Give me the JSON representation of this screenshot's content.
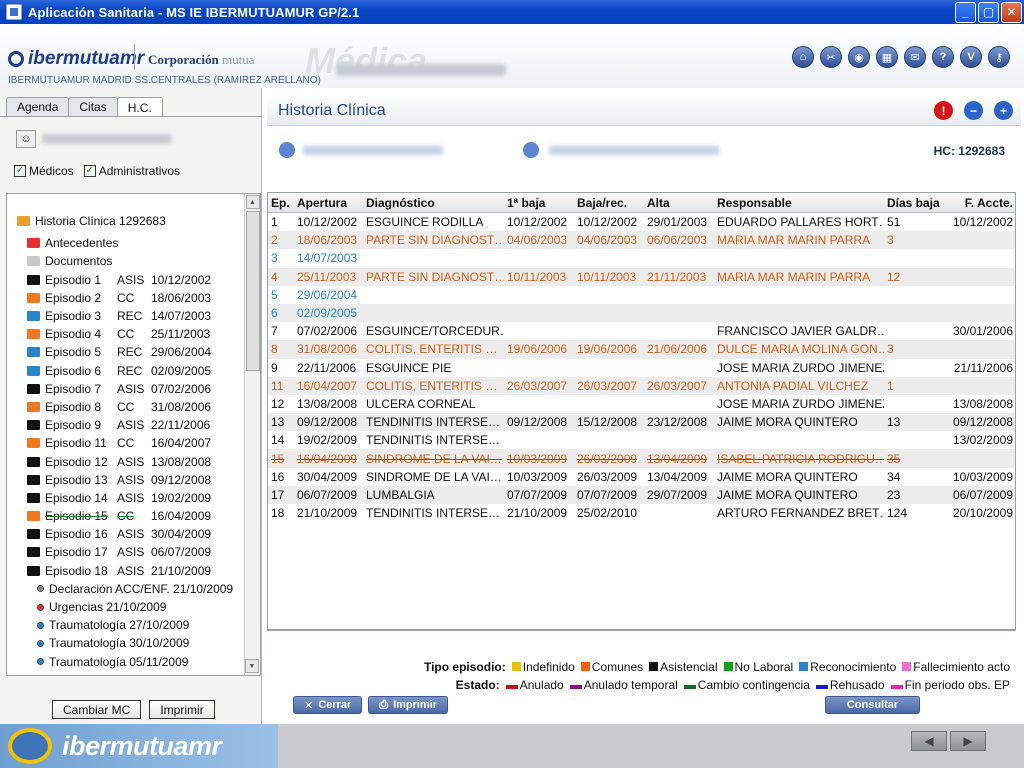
{
  "window": {
    "title": "Aplicación Sanitaria - MS IE IBERMUTUAMUR GP/2.1"
  },
  "header": {
    "logo_ibermutuamur": "ibermutuamr",
    "logo_corporacion": "Corporación",
    "logo_mutua": "mutua",
    "watermark": "Médica",
    "center": "IBERMUTUAMUR MADRID SS.CENTRALES (RAMIREZ ARELLANO)",
    "icons": [
      "home-icon",
      "tools-icon",
      "location-icon",
      "calculator-icon",
      "mail-icon",
      "help-icon",
      "user-icon",
      "key-icon"
    ],
    "icon_glyphs": [
      "⌂",
      "✂",
      "◉",
      "▦",
      "✉",
      "?",
      "V",
      "⚷"
    ]
  },
  "left": {
    "tabs": [
      "Agenda",
      "Citas",
      "H.C."
    ],
    "active_tab": "H.C.",
    "filters": [
      {
        "label": "Médicos",
        "checked": true
      },
      {
        "label": "Administrativos",
        "checked": true
      }
    ],
    "tree": [
      {
        "text": "Historia Clínica 1292683",
        "kind": "root",
        "color": "#e8a030"
      },
      {
        "text": "Antecedentes",
        "kind": "folder",
        "color": "#e83030"
      },
      {
        "text": "Documentos",
        "kind": "folder",
        "color": "#c8c8c8"
      },
      {
        "ep": "Episodio 1",
        "type": "ASIS",
        "date": "10/12/2002",
        "color": "#111111"
      },
      {
        "ep": "Episodio 2",
        "type": "CC",
        "date": "18/06/2003",
        "color": "#f07820"
      },
      {
        "ep": "Episodio 3",
        "type": "REC",
        "date": "14/07/2003",
        "color": "#2a85c8"
      },
      {
        "ep": "Episodio 4",
        "type": "CC",
        "date": "25/11/2003",
        "color": "#f07820"
      },
      {
        "ep": "Episodio 5",
        "type": "REC",
        "date": "29/06/2004",
        "color": "#2a85c8"
      },
      {
        "ep": "Episodio 6",
        "type": "REC",
        "date": "02/09/2005",
        "color": "#2a85c8"
      },
      {
        "ep": "Episodio 7",
        "type": "ASIS",
        "date": "07/02/2006",
        "color": "#111111"
      },
      {
        "ep": "Episodio 8",
        "type": "CC",
        "date": "31/08/2006",
        "color": "#f07820"
      },
      {
        "ep": "Episodio 9",
        "type": "ASIS",
        "date": "22/11/2006",
        "color": "#111111"
      },
      {
        "ep": "Episodio 11",
        "type": "CC",
        "date": "16/04/2007",
        "color": "#f07820"
      },
      {
        "ep": "Episodio 12",
        "type": "ASIS",
        "date": "13/08/2008",
        "color": "#111111"
      },
      {
        "ep": "Episodio 13",
        "type": "ASIS",
        "date": "09/12/2008",
        "color": "#111111"
      },
      {
        "ep": "Episodio 14",
        "type": "ASIS",
        "date": "19/02/2009",
        "color": "#111111"
      },
      {
        "ep": "Episodio 15",
        "type": "CC",
        "date": "16/04/2009",
        "color": "#f07820",
        "struck": true
      },
      {
        "ep": "Episodio 16",
        "type": "ASIS",
        "date": "30/04/2009",
        "color": "#111111"
      },
      {
        "ep": "Episodio 17",
        "type": "ASIS",
        "date": "06/07/2009",
        "color": "#111111"
      },
      {
        "ep": "Episodio 18",
        "type": "ASIS",
        "date": "21/10/2009",
        "color": "#111111"
      },
      {
        "text": "Declaración ACC/ENF. 21/10/2009",
        "kind": "child",
        "color": "#8a8a8a"
      },
      {
        "text": "Urgencias 21/10/2009",
        "kind": "child",
        "color": "#e83030"
      },
      {
        "text": "Traumatología 27/10/2009",
        "kind": "child",
        "color": "#2a85c8"
      },
      {
        "text": "Traumatología 30/10/2009",
        "kind": "child",
        "color": "#2a85c8"
      },
      {
        "text": "Traumatología 05/11/2009",
        "kind": "child",
        "color": "#2a85c8"
      }
    ],
    "buttons": {
      "change": "Cambiar MC",
      "print": "Imprimir"
    }
  },
  "main": {
    "title": "Historia Clínica",
    "hc_label": "HC:",
    "hc_number": "1292683",
    "columns": [
      "Ep.",
      "Apertura",
      "Diagnóstico",
      "1ª baja",
      "Baja/rec.",
      "Alta",
      "Responsable",
      "Días baja",
      "F. Accte."
    ],
    "rows": [
      {
        "ep": "1",
        "ap": "10/12/2002",
        "dx": "ESGUINCE RODILLA",
        "b1": "10/12/2002",
        "br": "10/12/2002",
        "al": "29/01/2003",
        "re": "EDUARDO PALLARES HORT…",
        "db": "51",
        "fa": "10/12/2002",
        "c": "black"
      },
      {
        "ep": "2",
        "ap": "18/06/2003",
        "dx": "PARTE SIN DIAGNOST…",
        "b1": "04/06/2003",
        "br": "04/06/2003",
        "al": "06/06/2003",
        "re": "MARIA MAR MARIN PARRA",
        "db": "3",
        "fa": "",
        "c": "orange"
      },
      {
        "ep": "3",
        "ap": "14/07/2003",
        "dx": "",
        "b1": "",
        "br": "",
        "al": "",
        "re": "",
        "db": "",
        "fa": "",
        "c": "blue"
      },
      {
        "ep": "4",
        "ap": "25/11/2003",
        "dx": "PARTE SIN DIAGNOST…",
        "b1": "10/11/2003",
        "br": "10/11/2003",
        "al": "21/11/2003",
        "re": "MARIA MAR MARIN PARRA",
        "db": "12",
        "fa": "",
        "c": "orange"
      },
      {
        "ep": "5",
        "ap": "29/06/2004",
        "dx": "",
        "b1": "",
        "br": "",
        "al": "",
        "re": "",
        "db": "",
        "fa": "",
        "c": "blue"
      },
      {
        "ep": "6",
        "ap": "02/09/2005",
        "dx": "",
        "b1": "",
        "br": "",
        "al": "",
        "re": "",
        "db": "",
        "fa": "",
        "c": "blue"
      },
      {
        "ep": "7",
        "ap": "07/02/2006",
        "dx": "ESGUINCE/TORCEDUR…",
        "b1": "",
        "br": "",
        "al": "",
        "re": "FRANCISCO JAVIER GALDR…",
        "db": "",
        "fa": "30/01/2006",
        "c": "black"
      },
      {
        "ep": "8",
        "ap": "31/08/2006",
        "dx": "COLITIS, ENTERITIS …",
        "b1": "19/06/2006",
        "br": "19/06/2006",
        "al": "21/06/2006",
        "re": "DULCE MARIA MOLINA GON…",
        "db": "3",
        "fa": "",
        "c": "orange"
      },
      {
        "ep": "9",
        "ap": "22/11/2006",
        "dx": "ESGUINCE PIE",
        "b1": "",
        "br": "",
        "al": "",
        "re": "JOSE MARIA ZURDO JIMENEZ",
        "db": "",
        "fa": "21/11/2006",
        "c": "black"
      },
      {
        "ep": "11",
        "ap": "16/04/2007",
        "dx": "COLITIS, ENTERITIS …",
        "b1": "26/03/2007",
        "br": "26/03/2007",
        "al": "26/03/2007",
        "re": "ANTONIA PADIAL VILCHEZ",
        "db": "1",
        "fa": "",
        "c": "orange"
      },
      {
        "ep": "12",
        "ap": "13/08/2008",
        "dx": "ULCERA CORNEAL",
        "b1": "",
        "br": "",
        "al": "",
        "re": "JOSE MARIA ZURDO JIMENEZ",
        "db": "",
        "fa": "13/08/2008",
        "c": "black"
      },
      {
        "ep": "13",
        "ap": "09/12/2008",
        "dx": "TENDINITIS INTERSE…",
        "b1": "09/12/2008",
        "br": "15/12/2008",
        "al": "23/12/2008",
        "re": "JAIME MORA QUINTERO",
        "db": "13",
        "fa": "09/12/2008",
        "c": "black"
      },
      {
        "ep": "14",
        "ap": "19/02/2009",
        "dx": "TENDINITIS INTERSE…",
        "b1": "",
        "br": "",
        "al": "",
        "re": "",
        "db": "",
        "fa": "13/02/2009",
        "c": "black"
      },
      {
        "ep": "15",
        "ap": "16/04/2009",
        "dx": "SINDROME DE LA VAI…",
        "b1": "10/03/2009",
        "br": "26/03/2009",
        "al": "13/04/2009",
        "re": "ISABEL PATRICIA RODRIGU…",
        "db": "35",
        "fa": "",
        "c": "orange",
        "annulled": true
      },
      {
        "ep": "16",
        "ap": "30/04/2009",
        "dx": "SINDROME DE LA VAI…",
        "b1": "10/03/2009",
        "br": "26/03/2009",
        "al": "13/04/2009",
        "re": "JAIME MORA QUINTERO",
        "db": "34",
        "fa": "10/03/2009",
        "c": "black"
      },
      {
        "ep": "17",
        "ap": "06/07/2009",
        "dx": "LUMBALGIA",
        "b1": "07/07/2009",
        "br": "07/07/2009",
        "al": "29/07/2009",
        "re": "JAIME MORA QUINTERO",
        "db": "23",
        "fa": "06/07/2009",
        "c": "black"
      },
      {
        "ep": "18",
        "ap": "21/10/2009",
        "dx": "TENDINITIS INTERSE…",
        "b1": "21/10/2009",
        "br": "25/02/2010",
        "al": "",
        "re": "ARTURO FERNANDEZ BRET…",
        "db": "124",
        "fa": "20/10/2009",
        "c": "black"
      }
    ],
    "legend_type": {
      "title": "Tipo episodio:",
      "items": [
        {
          "label": "Indefinido",
          "color": "#e8c000"
        },
        {
          "label": "Comunes",
          "color": "#f06010"
        },
        {
          "label": "Asistencial",
          "color": "#111111"
        },
        {
          "label": "No Laboral",
          "color": "#18a018"
        },
        {
          "label": "Reconocimiento",
          "color": "#2a85c8"
        },
        {
          "label": "Fallecimiento acto",
          "color": "#f070d0"
        }
      ]
    },
    "legend_state": {
      "title": "Estado:",
      "items": [
        {
          "label": "Anulado",
          "color": "#cc1010"
        },
        {
          "label": "Anulado temporal",
          "color": "#8a1090"
        },
        {
          "label": "Cambio contingencia",
          "color": "#107020"
        },
        {
          "label": "Rehusado",
          "color": "#1020c0"
        },
        {
          "label": "Fin periodo obs. EP",
          "color": "#f020c0"
        }
      ]
    },
    "buttons": {
      "close": "Cerrar",
      "print": "Imprimir",
      "consult": "Consultar"
    }
  },
  "footer": {
    "brand": "ibermutuamr"
  }
}
